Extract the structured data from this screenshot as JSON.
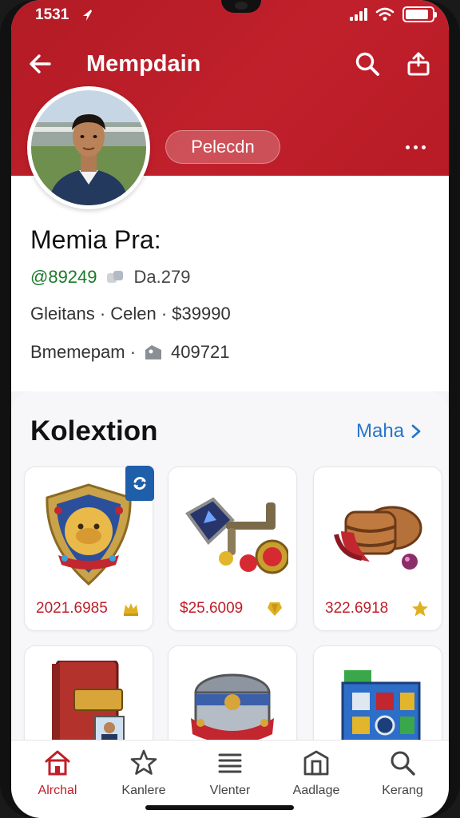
{
  "status": {
    "time": "1531"
  },
  "header": {
    "title": "Mempdain",
    "role_pill": "Pelecdn"
  },
  "profile": {
    "name": "Memia Pra:",
    "handle": "@89249",
    "code": "Da.279",
    "line2": "Gleitans · Celen · $39990",
    "line3_label": "Bmemepam ·",
    "line3_value": "409721"
  },
  "collection": {
    "title": "Kolextion",
    "more_label": "Maha",
    "items": [
      {
        "price": "2021.6985",
        "currency_icon": "crown-icon"
      },
      {
        "price": "$25.6009",
        "currency_icon": "gem-icon"
      },
      {
        "price": "322.6918",
        "currency_icon": "star-icon"
      }
    ]
  },
  "tabs": [
    {
      "label": "Alrchal",
      "icon": "home-icon",
      "active": true
    },
    {
      "label": "Kanlere",
      "icon": "star-icon",
      "active": false
    },
    {
      "label": "Vlenter",
      "icon": "list-icon",
      "active": false
    },
    {
      "label": "Aadlage",
      "icon": "store-icon",
      "active": false
    },
    {
      "label": "Kerang",
      "icon": "search-icon",
      "active": false
    }
  ],
  "colors": {
    "brand": "#c0202b",
    "link": "#2775c9",
    "handle": "#1a7a2a"
  }
}
